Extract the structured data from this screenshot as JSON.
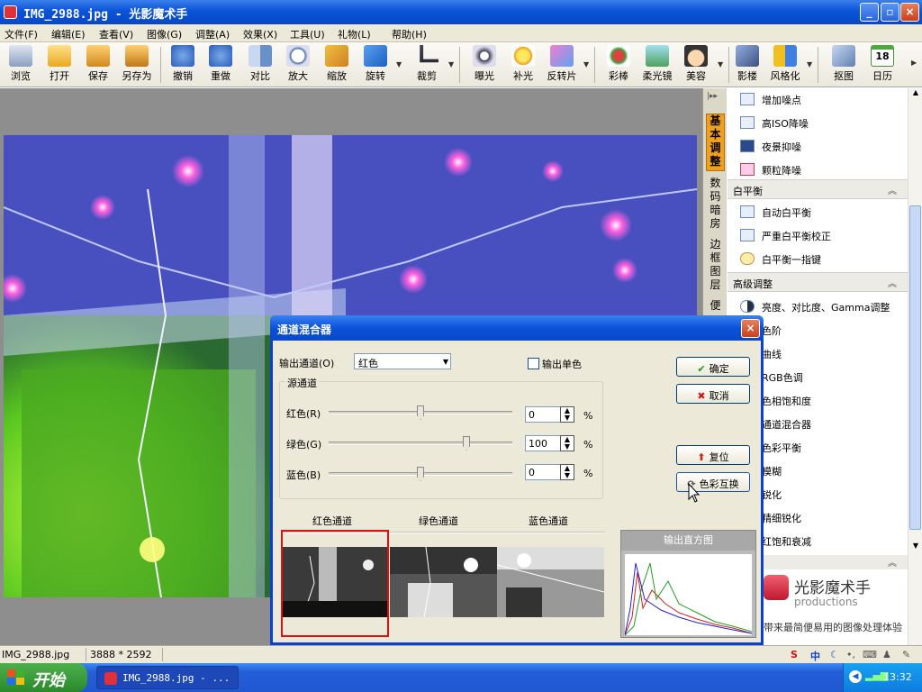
{
  "window": {
    "title": "IMG_2988.jpg - 光影魔术手",
    "min": "_",
    "max": "▫",
    "close": "×"
  },
  "menu": [
    "文件(F)",
    "编辑(E)",
    "查看(V)",
    "图像(G)",
    "调整(A)",
    "效果(X)",
    "工具(U)",
    "礼物(L)",
    "帮助(H)"
  ],
  "toolbar": [
    "浏览",
    "打开",
    "保存",
    "另存为",
    "撤销",
    "重做",
    "对比",
    "放大",
    "缩放",
    "旋转",
    "裁剪",
    "曝光",
    "补光",
    "反转片",
    "彩棒",
    "柔光镜",
    "美容",
    "影楼",
    "风格化",
    "抠图",
    "日历"
  ],
  "sidetabs": [
    "基本调整",
    "数码暗房",
    "边框图层",
    "便"
  ],
  "panel": {
    "noise_items": [
      "增加噪点",
      "高ISO降噪",
      "夜景抑噪",
      "颗粒降噪"
    ],
    "wb_header": "白平衡",
    "wb_items": [
      "自动白平衡",
      "严重白平衡校正",
      "白平衡一指键"
    ],
    "adv_header": "高级调整",
    "adv_items": [
      "亮度、对比度、Gamma调整",
      "色阶",
      "曲线",
      "RGB色调",
      "色相饱和度",
      "通道混合器",
      "色彩平衡",
      "模糊",
      "锐化",
      "精细锐化",
      "红饱和衰减"
    ],
    "brand_name": "光影魔术手",
    "brand_sub": "productions",
    "brand_slogan": "带来最简便易用的图像处理体验",
    "calendar_day": "18"
  },
  "status": {
    "file": "IMG_2988.jpg",
    "dims": "3888 * 2592"
  },
  "taskbar": {
    "start": "开始",
    "item": "IMG_2988.jpg - ...",
    "clock": "13:32",
    "ime": "中"
  },
  "dialog": {
    "title": "通道混合器",
    "output_label": "输出通道(O)",
    "output_value": "红色",
    "mono_label": "输出单色",
    "mono_checked": false,
    "source_group": "源通道",
    "sliders": [
      {
        "label": "红色(R)",
        "value": "0",
        "unit": "%",
        "level": 0.5
      },
      {
        "label": "绿色(G)",
        "value": "100",
        "unit": "%",
        "level": 0.75
      },
      {
        "label": "蓝色(B)",
        "value": "0",
        "unit": "%",
        "level": 0.5
      }
    ],
    "ok": "确定",
    "cancel": "取消",
    "reset": "复位",
    "swap": "色彩互换",
    "channels": [
      "红色通道",
      "绿色通道",
      "蓝色通道"
    ],
    "histogram_title": "输出直方图"
  },
  "colors": {
    "accent": "#0a52d8",
    "selected_channel": "#e01010"
  }
}
